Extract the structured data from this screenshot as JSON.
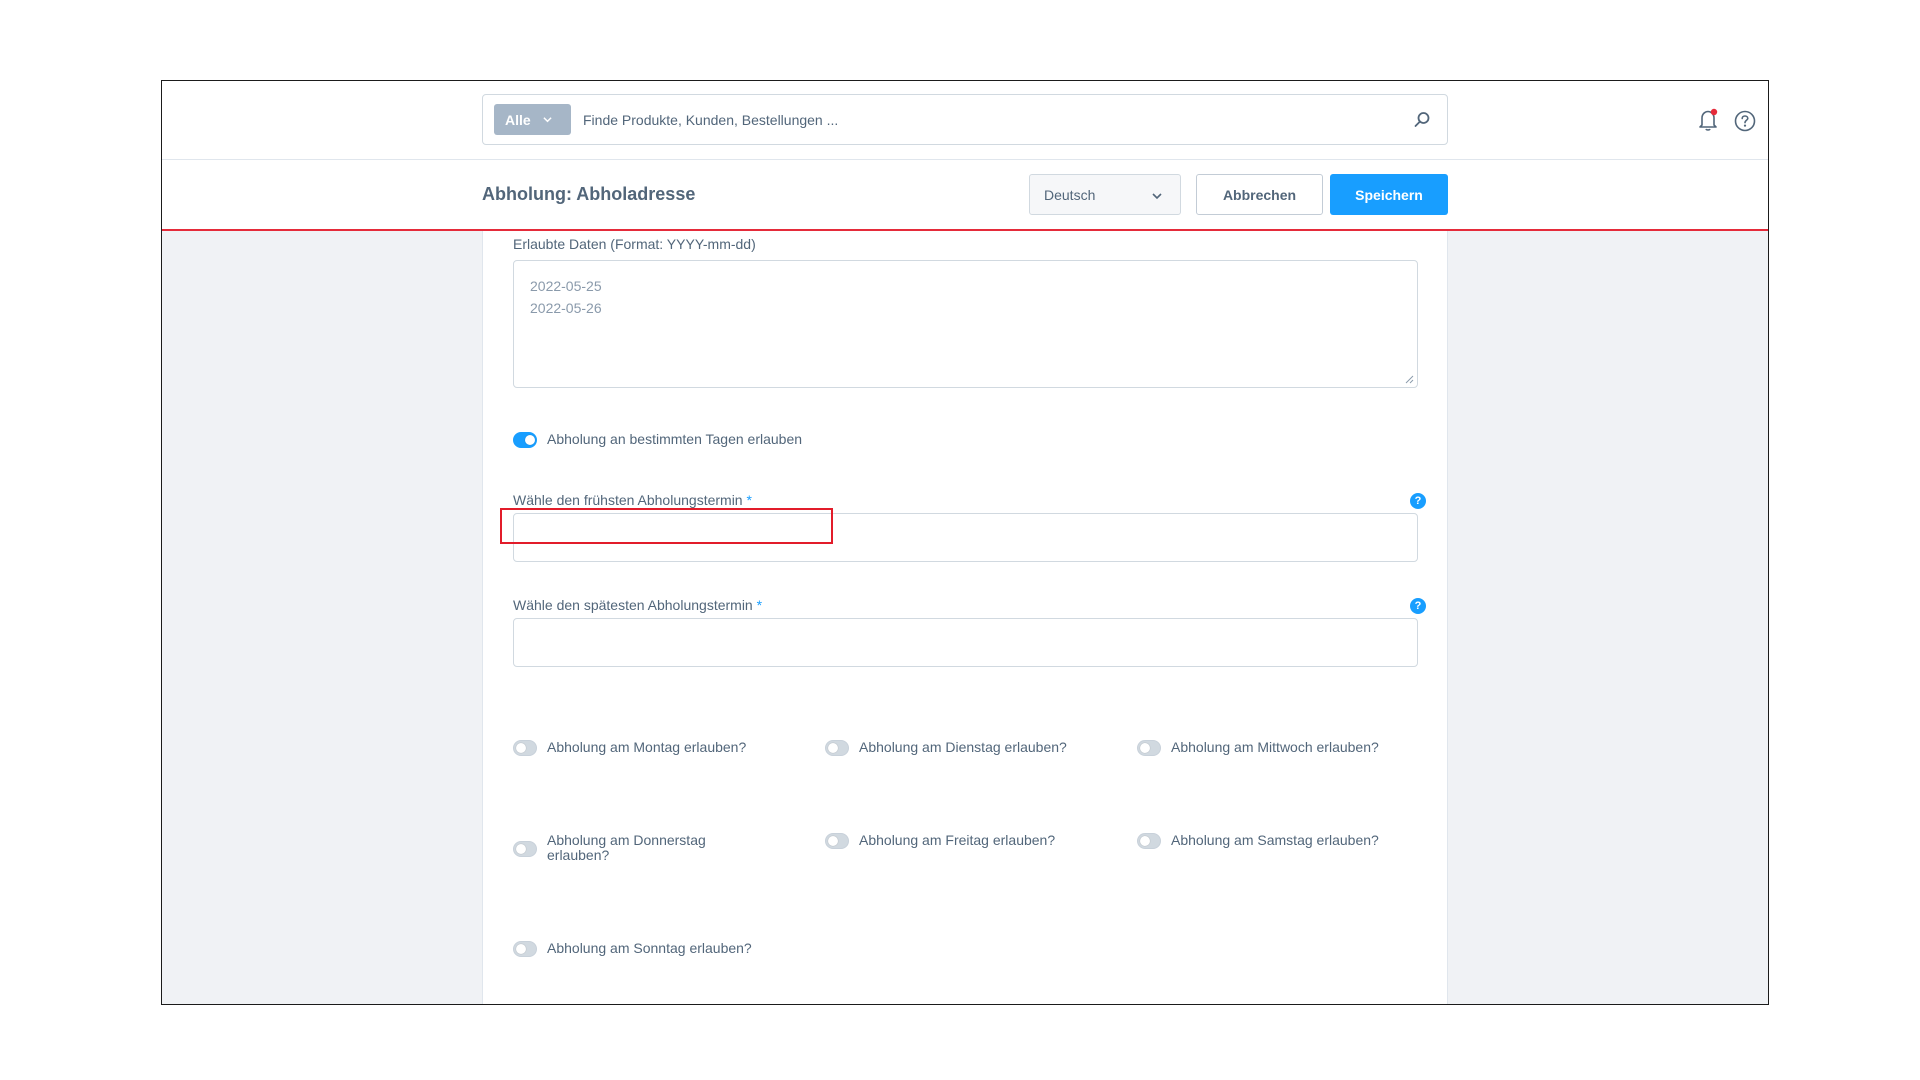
{
  "search": {
    "type_label": "Alle",
    "placeholder": "Finde Produkte, Kunden, Bestellungen ..."
  },
  "header": {
    "title": "Abholung: Abholadresse",
    "language": "Deutsch",
    "cancel_label": "Abbrechen",
    "save_label": "Speichern"
  },
  "form": {
    "allowed_dates_label": "Erlaubte Daten (Format: YYYY-mm-dd)",
    "allowed_dates": [
      "2022-05-25",
      "2022-05-26"
    ],
    "specific_days_toggle": {
      "label": "Abholung an bestimmten Tagen erlauben",
      "on": true
    },
    "earliest_label": "Wähle den frühsten Abholungstermin",
    "latest_label": "Wähle den spätesten Abholungstermin",
    "required_mark": "*",
    "info_glyph": "?",
    "weekdays": [
      {
        "label": "Abholung am Montag erlauben?",
        "on": false
      },
      {
        "label": "Abholung am Dienstag erlauben?",
        "on": false
      },
      {
        "label": "Abholung am Mittwoch erlauben?",
        "on": false
      },
      {
        "label": "Abholung am Donnerstag erlauben?",
        "on": false
      },
      {
        "label": "Abholung am Freitag erlauben?",
        "on": false
      },
      {
        "label": "Abholung am Samstag erlauben?",
        "on": false
      },
      {
        "label": "Abholung am Sonntag erlauben?",
        "on": false
      }
    ]
  },
  "colors": {
    "accent": "#189eff",
    "highlight": "#e21c2a",
    "notification_dot": "#e52b3a",
    "text": "#52667a"
  },
  "icons": {
    "search": "search-icon",
    "bell": "bell-icon",
    "help": "help-icon",
    "chevron": "chevron-down-icon"
  }
}
